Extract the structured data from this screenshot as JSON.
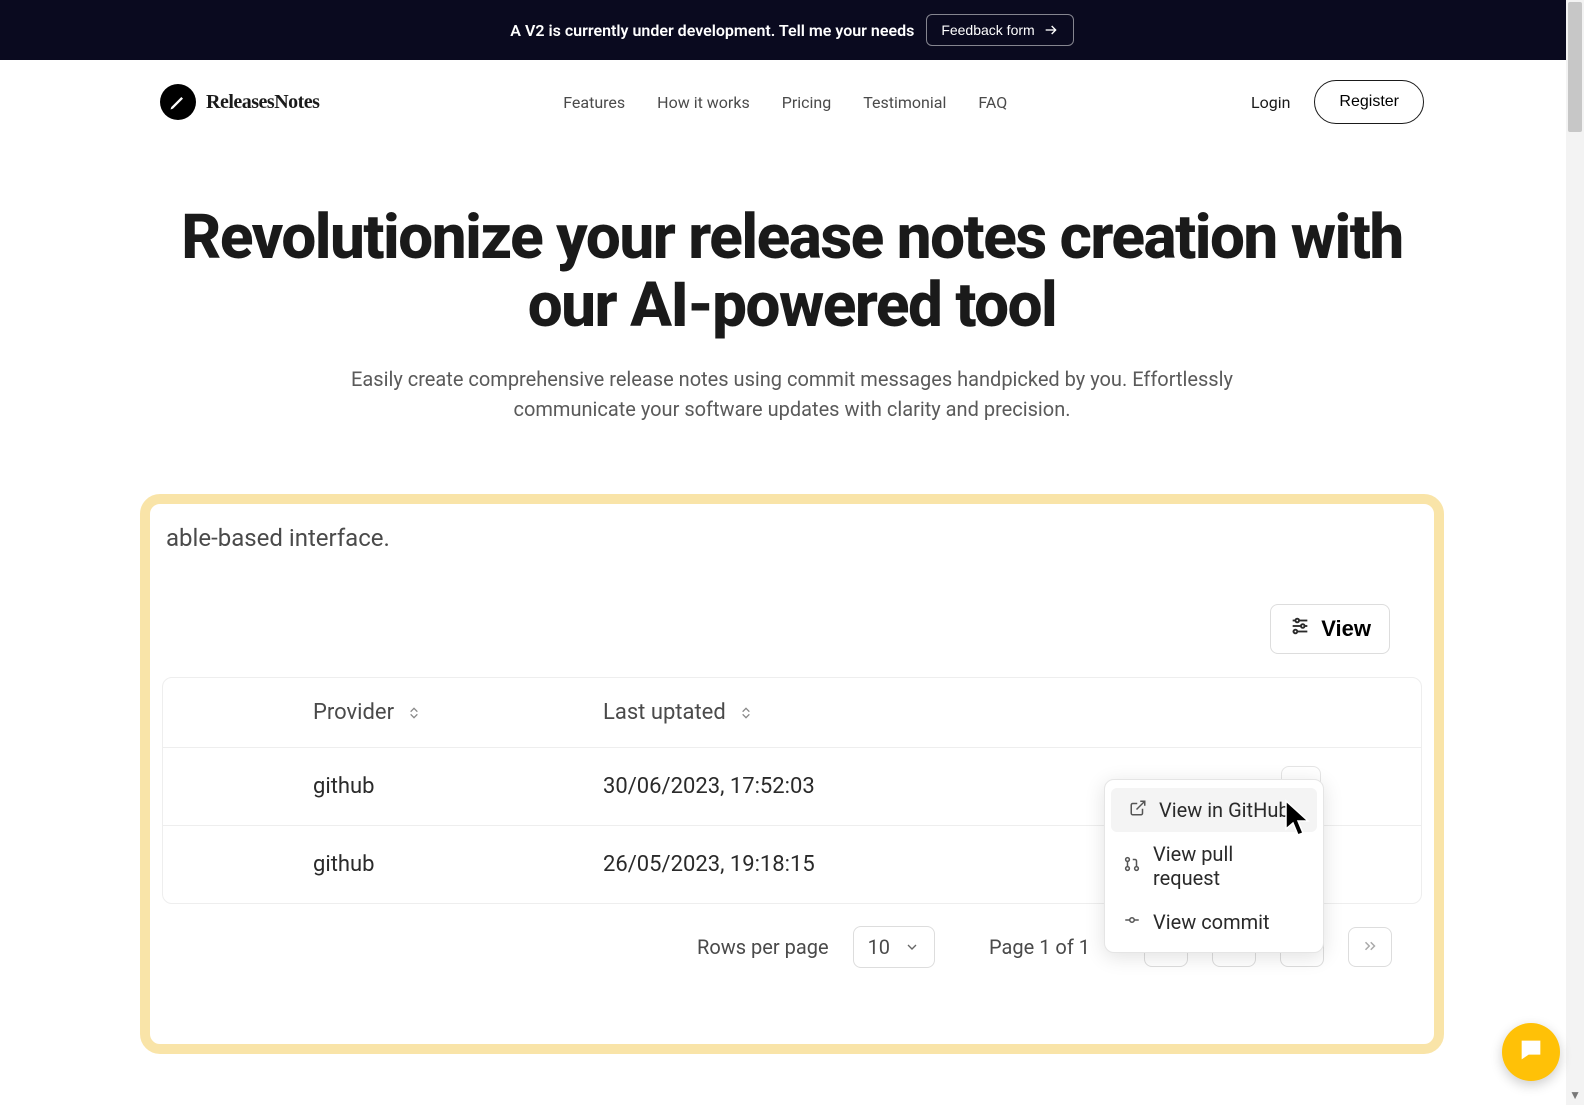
{
  "banner": {
    "text": "A V2 is currently under development. Tell me your needs",
    "button": "Feedback form"
  },
  "brand": "ReleasesNotes",
  "nav": {
    "items": [
      "Features",
      "How it works",
      "Pricing",
      "Testimonial",
      "FAQ"
    ],
    "login": "Login",
    "register": "Register"
  },
  "hero": {
    "title": "Revolutionize your release notes creation with our AI-powered tool",
    "subtitle": "Easily create comprehensive release notes using commit messages handpicked by you. Effortlessly communicate your software updates with clarity and precision."
  },
  "demo": {
    "partial_text": "able-based interface.",
    "view_button": "View",
    "columns": {
      "provider": "Provider",
      "updated": "Last uptated"
    },
    "rows": [
      {
        "provider": "github",
        "updated": "30/06/2023, 17:52:03"
      },
      {
        "provider": "github",
        "updated": "26/05/2023, 19:18:15"
      }
    ],
    "dropdown": {
      "view_github": "View in GitHub",
      "view_pr": "View pull request",
      "view_commit": "View commit"
    },
    "pagination": {
      "rows_label": "Rows per page",
      "rows_value": "10",
      "page_text": "Page 1 of 1"
    }
  },
  "colors": {
    "banner_bg": "#0a0a1f",
    "frame_border": "#f9e4a8",
    "fab": "#ffc107"
  }
}
